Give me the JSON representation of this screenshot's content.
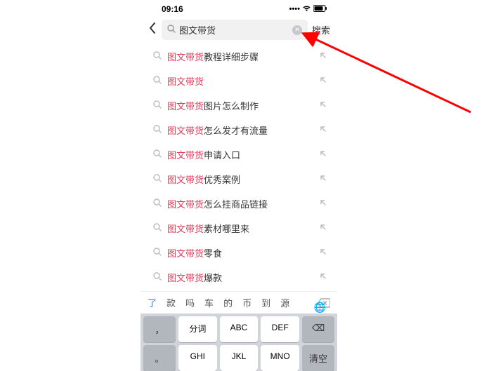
{
  "status": {
    "time": "09:16",
    "signal": "⠿",
    "wifi": "ᯤ",
    "battery": "▮▯"
  },
  "search": {
    "value": "图文带货",
    "button_label": "搜索"
  },
  "suggestions": [
    {
      "prefix": "图文带货",
      "suffix": "教程详细步骤"
    },
    {
      "prefix": "图文带货",
      "suffix": ""
    },
    {
      "prefix": "图文带货",
      "suffix": "图片怎么制作"
    },
    {
      "prefix": "图文带货",
      "suffix": "怎么发才有流量"
    },
    {
      "prefix": "图文带货",
      "suffix": "申请入口"
    },
    {
      "prefix": "图文带货",
      "suffix": "优秀案例"
    },
    {
      "prefix": "图文带货",
      "suffix": "怎么挂商品链接"
    },
    {
      "prefix": "图文带货",
      "suffix": "素材哪里来"
    },
    {
      "prefix": "图文带货",
      "suffix": "零食"
    },
    {
      "prefix": "图文带货",
      "suffix": "爆款"
    }
  ],
  "predictions": [
    "了",
    "款",
    "吗",
    "车",
    "的",
    "币",
    "到",
    "源"
  ],
  "keyboard": {
    "row1": [
      {
        "label": "，",
        "type": "func small"
      },
      {
        "label": "分词",
        "type": ""
      },
      {
        "label": "ABC",
        "type": ""
      },
      {
        "label": "DEF",
        "type": ""
      },
      {
        "label": "⌫",
        "type": "func small"
      }
    ],
    "row2": [
      {
        "label": "。",
        "type": "func small"
      },
      {
        "label": "GHI",
        "type": ""
      },
      {
        "label": "JKL",
        "type": ""
      },
      {
        "label": "MNO",
        "type": ""
      },
      {
        "label": "清空",
        "type": "func small"
      }
    ]
  }
}
